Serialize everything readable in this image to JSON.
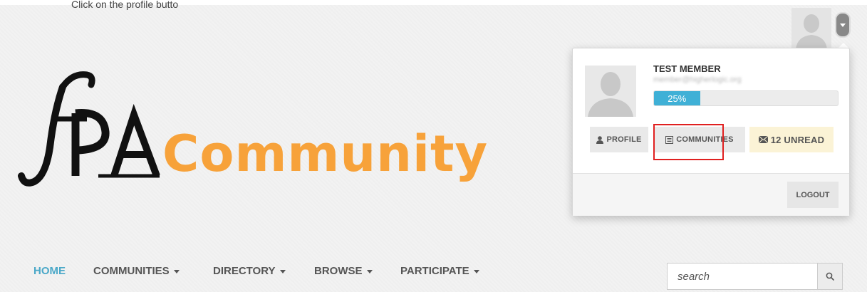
{
  "caption": "Click on the profile butto",
  "logo": {
    "mark_text": "fPA",
    "wordmark": "Community",
    "wordmark_color": "#f7a23a"
  },
  "user_menu": {
    "member_name": "TEST MEMBER",
    "member_email": "member@higherlogic.org",
    "progress_percent": 25,
    "progress_label": "25%",
    "profile_label": "PROFILE",
    "communities_label": "COMMUNITIES",
    "unread_label": "12 UNREAD",
    "logout_label": "LOGOUT",
    "highlight_color": "#e02020"
  },
  "nav": {
    "items": [
      {
        "label": "HOME",
        "active": true
      },
      {
        "label": "COMMUNITIES",
        "dropdown": true
      },
      {
        "label": "DIRECTORY",
        "dropdown": true
      },
      {
        "label": "BROWSE",
        "dropdown": true
      },
      {
        "label": "PARTICIPATE",
        "dropdown": true
      }
    ],
    "accent_color": "#4aa8c8"
  },
  "search": {
    "placeholder": "search",
    "icon": "search-icon"
  }
}
